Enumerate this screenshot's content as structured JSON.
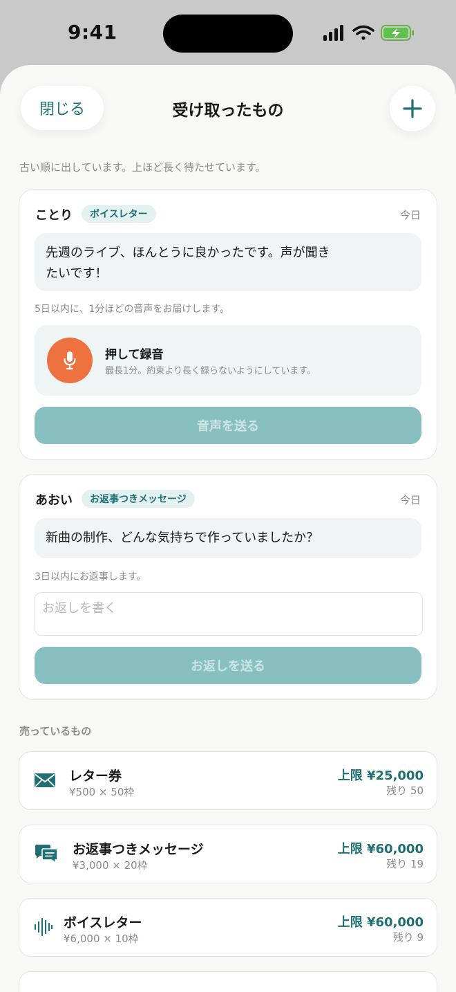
{
  "status_bar": {
    "time": "9:41"
  },
  "header": {
    "close_label": "閉じる",
    "title": "受け取ったもの"
  },
  "hint": "古い順に出しています。上ほど長く待たせています。",
  "requests": [
    {
      "sender": "ことり",
      "tag": "ボイスレター",
      "date": "今日",
      "message_line1": "先週のライブ、ほんとうに良かったです。声が聞き",
      "message_line2": "たいです！",
      "deadline": "5日以内に、1分ほどの音声をお届けします。",
      "record_title": "押して録音",
      "record_desc": "最長1分。約束より長く録らないようにしています。",
      "send_label": "音声を送る"
    },
    {
      "sender": "あおい",
      "tag": "お返事つきメッセージ",
      "date": "今日",
      "message": "新曲の制作、どんな気持ちで作っていましたか？",
      "deadline": "3日以内にお返事します。",
      "reply_placeholder": "お返しを書く",
      "send_label": "お返しを送る"
    }
  ],
  "selling_title": "売っているもの",
  "products": [
    {
      "icon": "envelope-icon",
      "name": "レター券",
      "price": "¥500 × 50枠",
      "limit": "上限 ¥25,000",
      "remaining": "残り 50"
    },
    {
      "icon": "chat-bubbles-icon",
      "name": "お返事つきメッセージ",
      "price": "¥3,000 × 20枠",
      "limit": "上限 ¥60,000",
      "remaining": "残り 19"
    },
    {
      "icon": "waveform-icon",
      "name": "ボイスレター",
      "price": "¥6,000 × 10枠",
      "limit": "上限 ¥60,000",
      "remaining": "残り 9"
    }
  ],
  "colors": {
    "accent": "#1f6f74",
    "record": "#ee7240",
    "disabled_button": "#88bfc0",
    "sheet_bg": "#f8f8f5"
  }
}
